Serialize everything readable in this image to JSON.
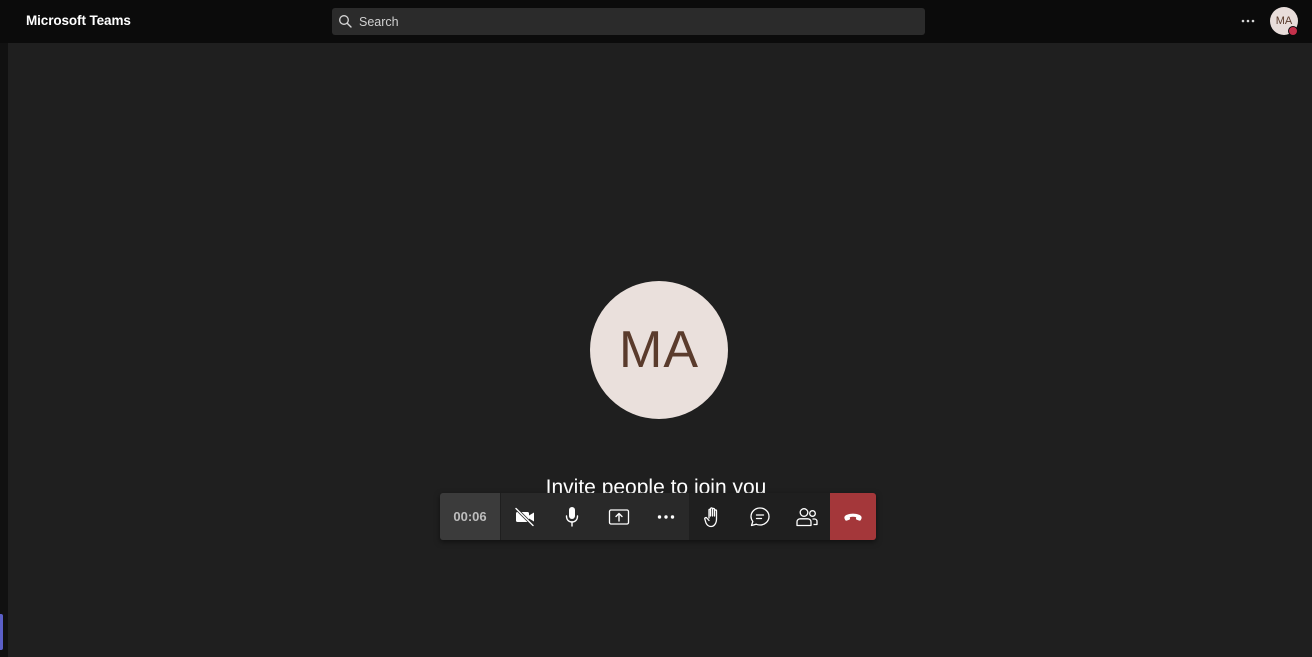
{
  "app": {
    "title": "Microsoft Teams"
  },
  "search": {
    "placeholder": "Search",
    "icon": "search-icon"
  },
  "header": {
    "more_icon": "more-horizontal-icon",
    "avatar_initials": "MA",
    "presence_color": "#c4314b"
  },
  "stage": {
    "avatar_initials": "MA",
    "avatar_bg": "#eae0dc",
    "avatar_fg": "#5a3b2c",
    "invite_text": "Invite people to join you"
  },
  "call_controls": {
    "timer": "00:06",
    "buttons": [
      {
        "name": "camera-off",
        "icon": "video-off-icon"
      },
      {
        "name": "mic",
        "icon": "microphone-icon"
      },
      {
        "name": "share",
        "icon": "share-screen-icon"
      },
      {
        "name": "more-actions",
        "icon": "more-horizontal-icon"
      },
      {
        "name": "raise-hand",
        "icon": "raise-hand-icon"
      },
      {
        "name": "chat",
        "icon": "chat-icon"
      },
      {
        "name": "participants",
        "icon": "people-icon"
      }
    ],
    "hangup_icon": "hang-up-icon",
    "hangup_color": "#a4373a"
  }
}
